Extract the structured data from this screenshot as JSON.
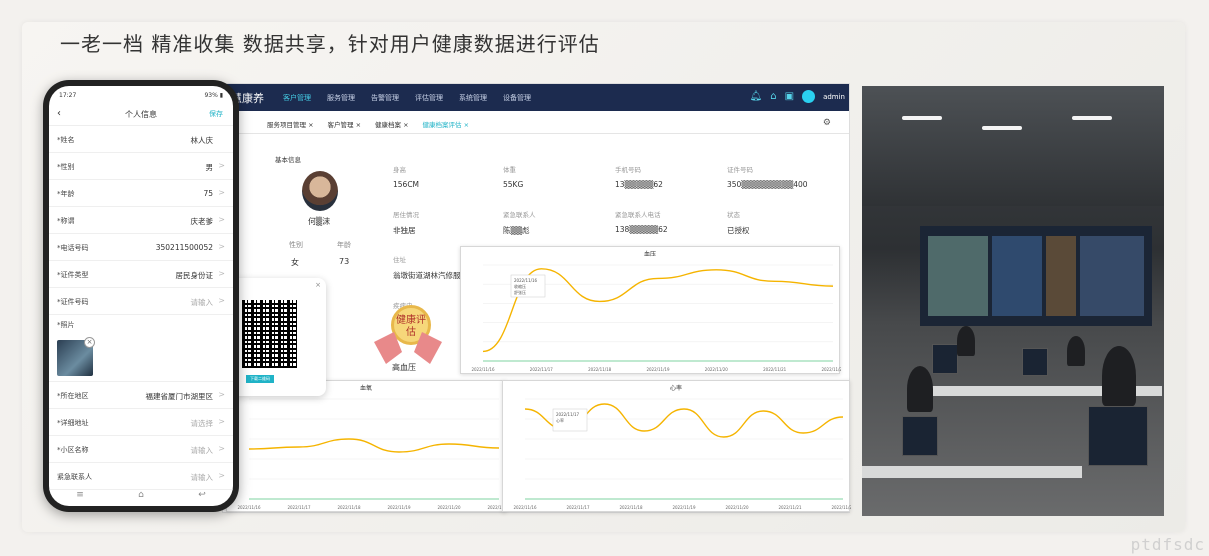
{
  "headline": "一老一档  精准收集 数据共享，针对用户健康数据进行评估",
  "watermark": "ptdfsdc",
  "dashboard": {
    "brand": "慧康养",
    "nav": [
      "客户管理",
      "服务管理",
      "告警管理",
      "评估管理",
      "系统管理",
      "设备管理"
    ],
    "user": "admin",
    "tabs": [
      "服务项目管理 ×",
      "客户管理 ×",
      "健康档案 ×",
      "健康档案评估 ×"
    ],
    "section_title": "基本信息",
    "person_name": "何▒沫",
    "gender_label": "性别",
    "gender_value": "女",
    "age_label": "年龄",
    "age_value": "73",
    "fields": [
      {
        "label": "身高",
        "value": "156CM"
      },
      {
        "label": "体重",
        "value": "55KG"
      },
      {
        "label": "手机号码",
        "value": "13▒▒▒▒▒62"
      },
      {
        "label": "证件号码",
        "value": "350▒▒▒▒▒▒▒▒▒400"
      },
      {
        "label": "居住情况",
        "value": "非独居"
      },
      {
        "label": "紧急联系人",
        "value": "陈▒▒彪"
      },
      {
        "label": "紧急联系人电话",
        "value": "138▒▒▒▒▒62"
      },
      {
        "label": "状态",
        "value": "已授权"
      }
    ],
    "address_label": "住址",
    "address_value": "翁墩街道湖林汽修服务",
    "history_label": "疾病史",
    "history_value": "高血压",
    "badge_text": "健康评估",
    "qr_button": "下载二维码"
  },
  "chart_data": [
    {
      "type": "line",
      "title": "血压",
      "x": [
        "2022/11/16",
        "2022/11/17",
        "2022/11/18",
        "2022/11/19",
        "2022/11/20",
        "2022/11/21",
        "2022/11/22"
      ],
      "series": [
        {
          "name": "收缩压",
          "values": [
            0.1,
            0.96,
            0.62,
            0.86,
            0.95,
            0.83,
            0.78
          ],
          "color": "#f5b400"
        }
      ],
      "ylim": [
        0,
        1
      ],
      "tooltip": [
        "2022/11/16",
        "收缩压",
        "舒张压"
      ]
    },
    {
      "type": "line",
      "title": "血氧",
      "x": [
        "2022/11/16",
        "2022/11/17",
        "2022/11/18",
        "2022/11/19",
        "2022/11/20",
        "2022/11/21"
      ],
      "series": [
        {
          "name": "血氧",
          "values": [
            0.5,
            0.52,
            0.6,
            0.47,
            0.55,
            0.51
          ],
          "color": "#f5b400"
        }
      ]
    },
    {
      "type": "line",
      "title": "心率",
      "x": [
        "2022/11/16",
        "2022/11/17",
        "2022/11/18",
        "2022/11/19",
        "2022/11/20",
        "2022/11/21",
        "2022/11/22"
      ],
      "series": [
        {
          "name": "心率",
          "values": [
            0.9,
            0.7,
            0.95,
            0.68,
            0.9,
            0.62,
            0.88,
            0.66,
            0.82
          ],
          "color": "#f5b400"
        }
      ],
      "ylim": [
        0,
        1
      ],
      "tooltip": [
        "2022/11/17",
        "心率"
      ]
    }
  ],
  "phone": {
    "status_time": "17:27",
    "status_right": "93% ▮",
    "title": "个人信息",
    "save": "保存",
    "rows": [
      {
        "label": "*姓名",
        "value": "林人庆",
        "arrow": ""
      },
      {
        "label": "*性别",
        "value": "男",
        "arrow": ">"
      },
      {
        "label": "*年龄",
        "value": "75",
        "arrow": ">"
      },
      {
        "label": "*称谓",
        "value": "庆老爹",
        "arrow": ">"
      },
      {
        "label": "*电话号码",
        "value": "350211500052",
        "arrow": ">"
      },
      {
        "label": "*证件类型",
        "value": "居民身份证",
        "arrow": ">"
      },
      {
        "label": "*证件号码",
        "value": "请输入",
        "arrow": ">"
      }
    ],
    "photo_label": "*照片",
    "rows2": [
      {
        "label": "*所在地区",
        "value": "福建省厦门市湖里区",
        "arrow": ">"
      },
      {
        "label": "*详细地址",
        "value": "请选择",
        "arrow": ">"
      },
      {
        "label": "*小区名称",
        "value": "请输入",
        "arrow": ">"
      },
      {
        "label": "紧急联系人",
        "value": "请输入",
        "arrow": ">"
      }
    ],
    "nav_icons": [
      "menu-icon",
      "home-icon",
      "back-icon"
    ]
  }
}
